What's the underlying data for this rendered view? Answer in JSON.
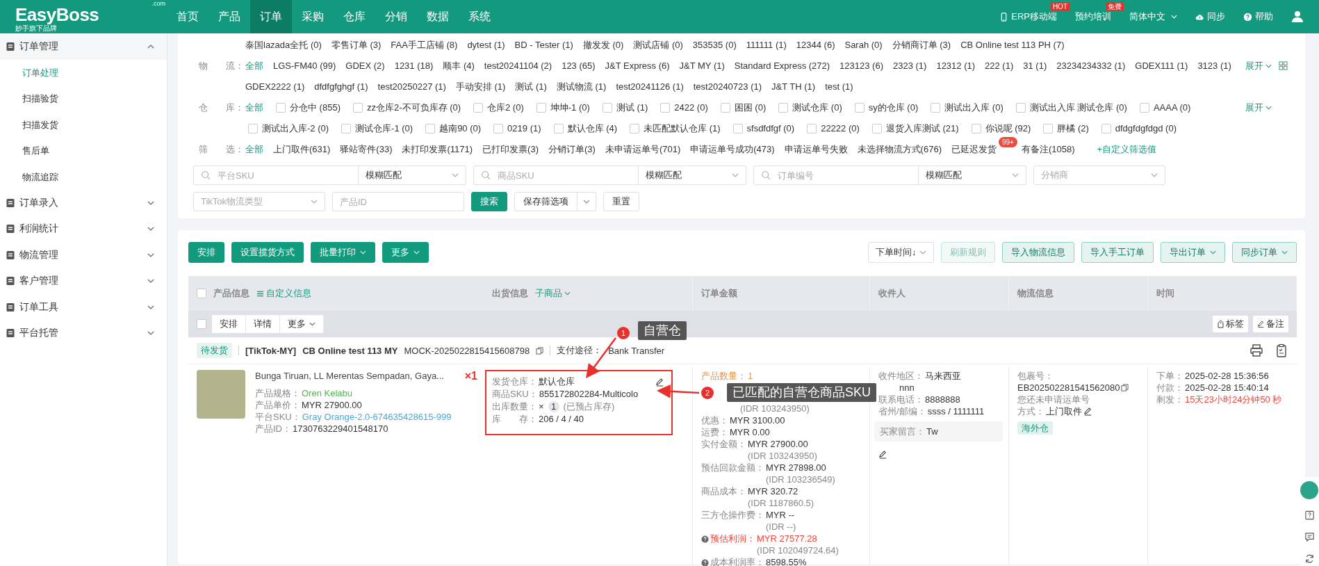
{
  "header": {
    "logo": "EasyBoss",
    "logo_domain": ".com",
    "tagline": "妙手旗下品牌",
    "nav": [
      {
        "label": "首页",
        "selected": false
      },
      {
        "label": "产品",
        "selected": false
      },
      {
        "label": "订单",
        "selected": true
      },
      {
        "label": "采购",
        "selected": false
      },
      {
        "label": "仓库",
        "selected": false
      },
      {
        "label": "分销",
        "selected": false
      },
      {
        "label": "数据",
        "selected": false
      },
      {
        "label": "系统",
        "selected": false
      }
    ],
    "links": [
      {
        "kind": "mobile",
        "label": "ERP移动端",
        "badge": "HOT"
      },
      {
        "kind": "plain",
        "label": "预约培训",
        "badge": "免费"
      },
      {
        "kind": "dropdown",
        "label": "简体中文"
      },
      {
        "kind": "cloud",
        "label": "同步"
      },
      {
        "kind": "help",
        "label": "帮助"
      }
    ]
  },
  "sidebar": [
    {
      "label": "订单管理",
      "expanded": true,
      "children": [
        {
          "label": "订单处理",
          "selected": true
        },
        {
          "label": "扫描验货",
          "selected": false
        },
        {
          "label": "扫描发货",
          "selected": false
        },
        {
          "label": "售后单",
          "selected": false
        },
        {
          "label": "物流追踪",
          "selected": false
        }
      ]
    },
    {
      "label": "订单录入",
      "expanded": false
    },
    {
      "label": "利润统计",
      "expanded": false
    },
    {
      "label": "物流管理",
      "expanded": false
    },
    {
      "label": "客户管理",
      "expanded": false
    },
    {
      "label": "订单工具",
      "expanded": false
    },
    {
      "label": "平台托管",
      "expanded": false
    }
  ],
  "filters": [
    {
      "kind": "plain",
      "options": [
        {
          "text": "泰国lazada全托 (0)",
          "selected": false
        },
        {
          "text": "零售订单 (3)",
          "selected": false
        },
        {
          "text": "FAA手工店铺 (8)",
          "selected": false
        },
        {
          "text": "dytest (1)",
          "selected": false
        },
        {
          "text": "BD - Tester (1)",
          "selected": false
        },
        {
          "text": "撤发发 (0)",
          "selected": false
        },
        {
          "text": "测试店铺 (0)",
          "selected": false
        },
        {
          "text": "353535 (0)",
          "selected": false
        },
        {
          "text": "111111 (1)",
          "selected": false
        },
        {
          "text": "12344 (6)",
          "selected": false
        },
        {
          "text": "Sarah (0)",
          "selected": false
        },
        {
          "text": "分销商订单 (3)",
          "selected": false
        },
        {
          "text": "CB Online test 113 PH (7)",
          "selected": false
        }
      ]
    },
    {
      "kind": "plain",
      "label": "物　　流：",
      "all": {
        "text": "全部",
        "selected": true
      },
      "more": "展开",
      "options": [
        {
          "text": "LGS-FM40 (99)",
          "selected": false
        },
        {
          "text": "GDEX (2)",
          "selected": false
        },
        {
          "text": "1231 (18)",
          "selected": false
        },
        {
          "text": "顺丰 (4)",
          "selected": false
        },
        {
          "text": "test20241104 (2)",
          "selected": false
        },
        {
          "text": "123 (65)",
          "selected": false
        },
        {
          "text": "J&T Express (6)",
          "selected": false
        },
        {
          "text": "J&T MY (1)",
          "selected": false
        },
        {
          "text": "Standard Express (272)",
          "selected": false
        },
        {
          "text": "123123 (6)",
          "selected": false
        },
        {
          "text": "2323 (1)",
          "selected": false
        },
        {
          "text": "12312 (1)",
          "selected": false
        },
        {
          "text": "222 (1)",
          "selected": false
        },
        {
          "text": "31 (1)",
          "selected": false
        },
        {
          "text": "23234234332 (1)",
          "selected": false
        },
        {
          "text": "GDEX111 (1)",
          "selected": false
        },
        {
          "text": "3123 (1)",
          "selected": false
        },
        {
          "text": "GDEX2222 (1)",
          "selected": false
        },
        {
          "text": "dfdfgfghgf (1)",
          "selected": false
        },
        {
          "text": "test20250227 (1)",
          "selected": false
        },
        {
          "text": "手动安排 (1)",
          "selected": false
        },
        {
          "text": "测试 (1)",
          "selected": false
        },
        {
          "text": "测试物流 (1)",
          "selected": false
        },
        {
          "text": "test20241126 (1)",
          "selected": false
        },
        {
          "text": "test20240723 (1)",
          "selected": false
        },
        {
          "text": "J&T TH (1)",
          "selected": false
        },
        {
          "text": "test (1)",
          "selected": false
        }
      ]
    },
    {
      "kind": "checkbox",
      "label": "仓　　库：",
      "all": {
        "text": "全部",
        "selected": true
      },
      "more": "展开",
      "options": [
        {
          "text": "分仓中 (855)",
          "checked": false
        },
        {
          "text": "zz仓库2-不可负库存 (0)",
          "checked": false
        },
        {
          "text": "仓库2 (0)",
          "checked": false
        },
        {
          "text": "坤坤-1 (0)",
          "checked": false
        },
        {
          "text": "测试 (1)",
          "checked": false
        },
        {
          "text": "2422 (0)",
          "checked": false
        },
        {
          "text": "困困 (0)",
          "checked": false
        },
        {
          "text": "测试仓库 (0)",
          "checked": false
        },
        {
          "text": "sy的仓库 (0)",
          "checked": false
        },
        {
          "text": "测试出入库 (0)",
          "checked": false
        },
        {
          "text": "测试出入库 测试仓库 (0)",
          "checked": false
        },
        {
          "text": "AAAA (0)",
          "checked": false
        },
        {
          "text": "测试出入库-2 (0)",
          "checked": false
        },
        {
          "text": "测试仓库-1 (0)",
          "checked": false
        },
        {
          "text": "越南90 (0)",
          "checked": false
        },
        {
          "text": "0219 (1)",
          "checked": false
        },
        {
          "text": "默认仓库 (4)",
          "checked": false
        },
        {
          "text": "未匹配默认仓库 (1)",
          "checked": false
        },
        {
          "text": "sfsdfdfgf (0)",
          "checked": false
        },
        {
          "text": "22222 (0)",
          "checked": false
        },
        {
          "text": "退货入库测试 (21)",
          "checked": false
        },
        {
          "text": "你说呢 (92)",
          "checked": false
        },
        {
          "text": "胖橘 (2)",
          "checked": false
        },
        {
          "text": "dfdgfdgfdgd (0)",
          "checked": false
        }
      ]
    },
    {
      "kind": "plain",
      "label": "筛　　选：",
      "all": {
        "text": "全部",
        "selected": true
      },
      "custom": "+自定义筛选值",
      "options": [
        {
          "text": "上门取件(631)",
          "selected": false
        },
        {
          "text": "驿站寄件(33)",
          "selected": false
        },
        {
          "text": "未打印发票(1171)",
          "selected": false
        },
        {
          "text": "已打印发票(3)",
          "selected": false
        },
        {
          "text": "分销订单(3)",
          "selected": false
        },
        {
          "text": "未申请运单号(701)",
          "selected": false
        },
        {
          "text": "申请运单号成功(473)",
          "selected": false
        },
        {
          "text": "申请运单号失败",
          "selected": false
        },
        {
          "text": "未选择物流方式(676)",
          "selected": false
        },
        {
          "text": "已延迟发货",
          "selected": false,
          "badge": "99+"
        },
        {
          "text": "有备注(1058)",
          "selected": false
        }
      ]
    }
  ],
  "search": {
    "fields": [
      {
        "kind": "search",
        "placeholder": "平台SKU",
        "match": "模糊匹配"
      },
      {
        "kind": "search",
        "placeholder": "商品SKU",
        "match": "模糊匹配"
      },
      {
        "kind": "search",
        "placeholder": "订单编号",
        "match": "模糊匹配"
      },
      {
        "kind": "select",
        "placeholder": "分销商"
      },
      {
        "kind": "select",
        "placeholder": "TikTok物流类型"
      },
      {
        "kind": "input",
        "placeholder": "产品ID"
      }
    ],
    "search_button": "搜索",
    "save_button": "保存筛选项",
    "reset_button": "重置"
  },
  "toolbar": {
    "left": [
      {
        "label": "安排",
        "dropdown": false
      },
      {
        "label": "设置揽货方式",
        "dropdown": false
      },
      {
        "label": "批量打印",
        "dropdown": true
      },
      {
        "label": "更多",
        "dropdown": true
      }
    ],
    "sort": "下单时间↓",
    "right": [
      {
        "label": "刷新规则",
        "disabled": true,
        "dropdown": false
      },
      {
        "label": "导入物流信息",
        "disabled": false,
        "dropdown": false
      },
      {
        "label": "导入手工订单",
        "disabled": false,
        "dropdown": false
      },
      {
        "label": "导出订单",
        "disabled": false,
        "dropdown": true
      },
      {
        "label": "同步订单",
        "disabled": false,
        "dropdown": true
      }
    ]
  },
  "table": {
    "header": {
      "product": "产品信息",
      "custom": "自定义信息",
      "shipping": "出货信息",
      "sub_items": "子商品",
      "amount": "订单金额",
      "receiver": "收件人",
      "logistics": "物流信息",
      "time": "时间"
    },
    "header_checked": false,
    "batch_checked": false,
    "batch_actions": [
      "安排",
      "详情",
      "更多"
    ],
    "tag_button": "标签",
    "note_button": "备注",
    "order": {
      "status": "待发货",
      "platform": "[TikTok-MY]",
      "store": "CB Online test 113 MY",
      "order_no": "MOCK-2025022815415608798",
      "payment_label": "支付途径：",
      "payment": "Bank Transfer",
      "product": {
        "title": "Bunga Tiruan, LL Merentas Sempadan, Gaya...",
        "quantity": "×1",
        "specs": [
          {
            "label": "产品规格：",
            "value": "Oren Kelabu",
            "kind": "success"
          },
          {
            "label": "产品单价：",
            "value": "MYR 27900.00",
            "kind": "plain"
          },
          {
            "label": "平台SKU：",
            "value": "Gray Orange-2.0-674635428615-999",
            "kind": "link"
          },
          {
            "label": "产品ID：",
            "value": "1730763229401548170",
            "kind": "plain"
          }
        ]
      },
      "shipping": {
        "warehouse_label": "发货仓库：",
        "warehouse": "默认仓库",
        "sku_label": "商品SKU：",
        "sku": "855172802284-Multicolo",
        "qty_label": "出库数量：",
        "qty_prefix": "×",
        "qty": "1",
        "qty_note": "(已预占库存)",
        "stock_label": "库　　存：",
        "stock": "206 / 4 / 40"
      },
      "amount": [
        {
          "label": "产品数量：",
          "value": "1",
          "kind": "warning",
          "hint": false
        },
        {
          "sub": "(IDR 103243950)",
          "hint": false
        },
        {
          "label": "优惠：",
          "value": "MYR 3100.00",
          "kind": "plain",
          "hint": false
        },
        {
          "label": "运费：",
          "value": "MYR 0.00",
          "kind": "plain",
          "hint": false
        },
        {
          "label": "实付金额：",
          "value": "MYR 27900.00",
          "sub": "(IDR 103243950)",
          "kind": "plain",
          "hint": false
        },
        {
          "label": "预估回款金额：",
          "value": "MYR 27898.00",
          "sub": "(IDR 103236549)",
          "kind": "plain",
          "hint": false
        },
        {
          "label": "商品成本：",
          "value": "MYR 320.72",
          "sub": "(IDR 1187860.5)",
          "kind": "plain",
          "hint": false
        },
        {
          "label": "三方仓操作费：",
          "value": "MYR --",
          "sub": "(IDR --)",
          "kind": "plain",
          "hint": false
        },
        {
          "label": "预估利润：",
          "value": "MYR 27577.28",
          "sub": "(IDR 102049724.64)",
          "kind": "alert",
          "hint": true
        },
        {
          "label": "成本利润率：",
          "value": "8598.55%",
          "kind": "plain",
          "hint": true
        }
      ],
      "receiver": [
        {
          "label": "收件地区：",
          "value": "马来西亚"
        },
        {
          "value": "nnn"
        },
        {
          "label": "联系电话：",
          "value": "8888888"
        },
        {
          "label": "省州/邮编：",
          "value": "ssss / 1111111"
        }
      ],
      "message": {
        "label": "买家留言：",
        "value": "Tw"
      },
      "logistics": {
        "package_label": "包裹号：",
        "package_no": "EB202502281541562080",
        "notice": "您还未申请运单号",
        "method_label": "方式：",
        "method": "上门取件",
        "tag": "海外仓"
      },
      "time": [
        {
          "label": "下单：",
          "value": "2025-02-28 15:36:56",
          "kind": "plain"
        },
        {
          "label": "付款：",
          "value": "2025-02-28 15:40:14",
          "kind": "plain"
        },
        {
          "label": "剩发：",
          "value": "15天23小时24分钟50 秒",
          "kind": "alert"
        }
      ]
    }
  },
  "annotations": [
    {
      "number": "1",
      "text": "自营仓"
    },
    {
      "number": "2",
      "text": "已匹配的自营仓商品SKU"
    }
  ]
}
